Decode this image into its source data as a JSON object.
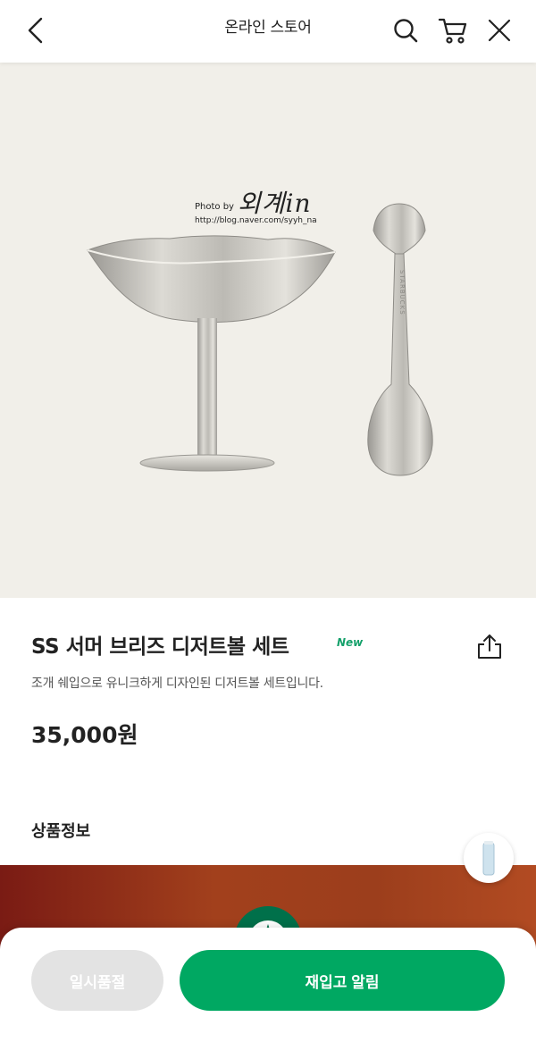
{
  "header": {
    "title": "온라인 스토어",
    "back_icon": "chevron-left-icon",
    "search_icon": "search-icon",
    "cart_icon": "cart-icon",
    "close_icon": "close-icon"
  },
  "hero": {
    "watermark": {
      "photo_by": "Photo by",
      "name": "외계in",
      "url": "http://blog.naver.com/syyh_na"
    },
    "spoon_engraving": "STARBUCKS"
  },
  "product": {
    "name": "SS 서머 브리즈 디저트볼 세트",
    "badge": "New",
    "description": "조개 쉐입으로 유니크하게 디자인된 디저트볼 세트입니다.",
    "price": "35,000원",
    "share_icon": "share-icon"
  },
  "section": {
    "title": "상품정보"
  },
  "actions": {
    "soldout_label": "일시품절",
    "restock_label": "재입고 알림"
  },
  "colors": {
    "brand_green": "#00a862",
    "new_badge": "#14a06a",
    "disabled": "#e3e3e3"
  }
}
